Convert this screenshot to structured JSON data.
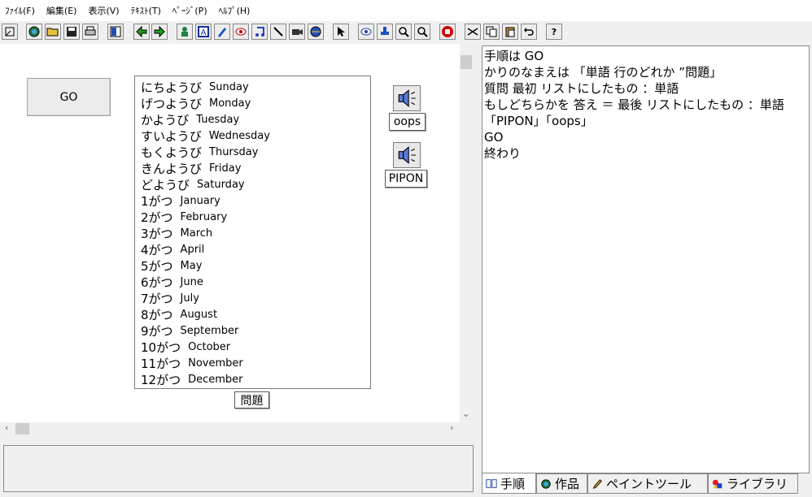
{
  "menu": [
    "ﾌｧｲﾙ(F)",
    "編集(E)",
    "表示(V)",
    "ﾃｷｽﾄ(T)",
    "ﾍﾟｰｼﾞ(P)",
    "ﾍﾙﾌﾟ(H)"
  ],
  "toolbar": {
    "help_label": "?"
  },
  "stage": {
    "go_label": "GO",
    "words": [
      {
        "jp": "にちようび",
        "en": "Sunday"
      },
      {
        "jp": "げつようび",
        "en": "Monday"
      },
      {
        "jp": "かようび",
        "en": "Tuesday"
      },
      {
        "jp": "すいようび",
        "en": "Wednesday"
      },
      {
        "jp": "もくようび",
        "en": "Thursday"
      },
      {
        "jp": "きんようび",
        "en": "Friday"
      },
      {
        "jp": "どようび",
        "en": "Saturday"
      },
      {
        "jp": "1がつ",
        "en": "January"
      },
      {
        "jp": "2がつ",
        "en": "February"
      },
      {
        "jp": "3がつ",
        "en": "March"
      },
      {
        "jp": "4がつ",
        "en": "April"
      },
      {
        "jp": "5がつ",
        "en": "May"
      },
      {
        "jp": "6がつ",
        "en": "June"
      },
      {
        "jp": "7がつ",
        "en": "July"
      },
      {
        "jp": "8がつ",
        "en": "August"
      },
      {
        "jp": "9がつ",
        "en": "September"
      },
      {
        "jp": "10がつ",
        "en": "October"
      },
      {
        "jp": "11がつ",
        "en": "November"
      },
      {
        "jp": "12がつ",
        "en": "December"
      }
    ],
    "sound1_label": "oops",
    "sound2_label": "PIPON",
    "mondai_label": "問題"
  },
  "script_lines": [
    "手順は  GO",
    "かりのなまえは 「単語  行のどれか  ”問題」",
    "質問  最初  リストにしたもの  ：単語",
    "もしどちらかを  答え  ＝  最後  リストにしたもの  ：単語",
    "「PIPON」「oops」",
    "GO",
    "終わり"
  ],
  "tabs": [
    "手順",
    "作品",
    "ペイントツール",
    "ライブラリ"
  ]
}
